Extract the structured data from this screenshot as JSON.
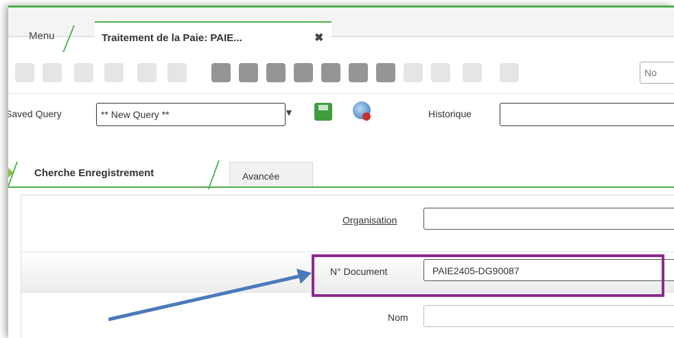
{
  "window_tabs": {
    "menu_label": "Menu",
    "active_label": "Traitement de la Paie: PAIE...",
    "close_glyph": "✖"
  },
  "toolbar": {
    "icons": [
      "undo-icon",
      "new-record-icon",
      "refresh-icon",
      "copy-record-icon",
      "save-icon",
      "copy-icon",
      "print-icon",
      "grid-icon",
      "delete-icon",
      "delete-selection-icon",
      "zoom-across-icon",
      "find-icon",
      "chart-icon",
      "process-icon",
      "attachment-icon",
      "user-icon",
      "archive-icon"
    ],
    "search_placeholder": "No"
  },
  "query": {
    "label": "Saved Query",
    "selected": "** New Query **",
    "history_label": "Historique",
    "history_value": ""
  },
  "subtabs": {
    "active": "Cherche Enregistrement",
    "other": "Avancée"
  },
  "form": {
    "organisation_label": "Organisation",
    "organisation_value": "",
    "document_label": "N° Document",
    "document_value": "PAIE2405-DG90087",
    "nom_label": "Nom",
    "nom_value": ""
  },
  "colors": {
    "accent": "#4bb04b",
    "highlight": "#8e2a8e",
    "annotation_arrow": "#4a7ab9",
    "tab_arrow": "#8bbf3f"
  }
}
